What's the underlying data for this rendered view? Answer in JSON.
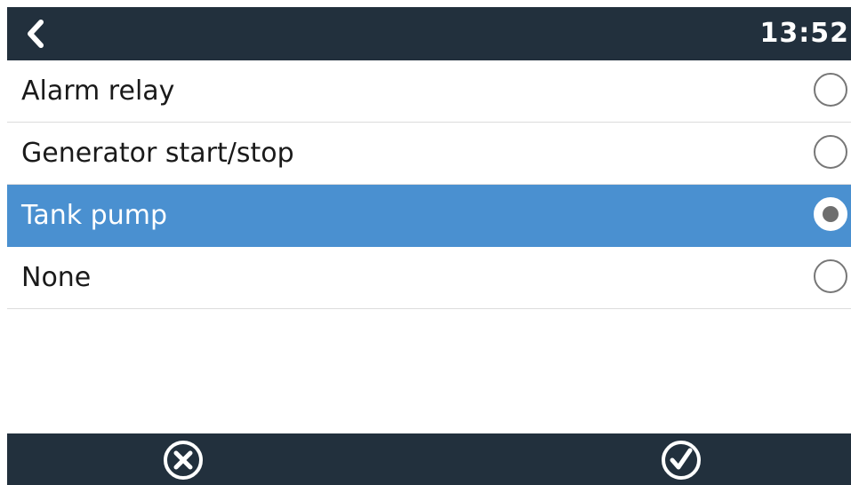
{
  "header": {
    "back_icon": "chevron-left-icon",
    "time": "13:52"
  },
  "options": [
    {
      "label": "Alarm relay",
      "selected": false
    },
    {
      "label": "Generator start/stop",
      "selected": false
    },
    {
      "label": "Tank pump",
      "selected": true
    },
    {
      "label": "None",
      "selected": false
    }
  ],
  "footer": {
    "cancel_icon": "circle-x-icon",
    "confirm_icon": "circle-check-icon"
  },
  "colors": {
    "header_bg": "#22303d",
    "selected_bg": "#4a90d0",
    "footer_bg": "#22303d"
  }
}
